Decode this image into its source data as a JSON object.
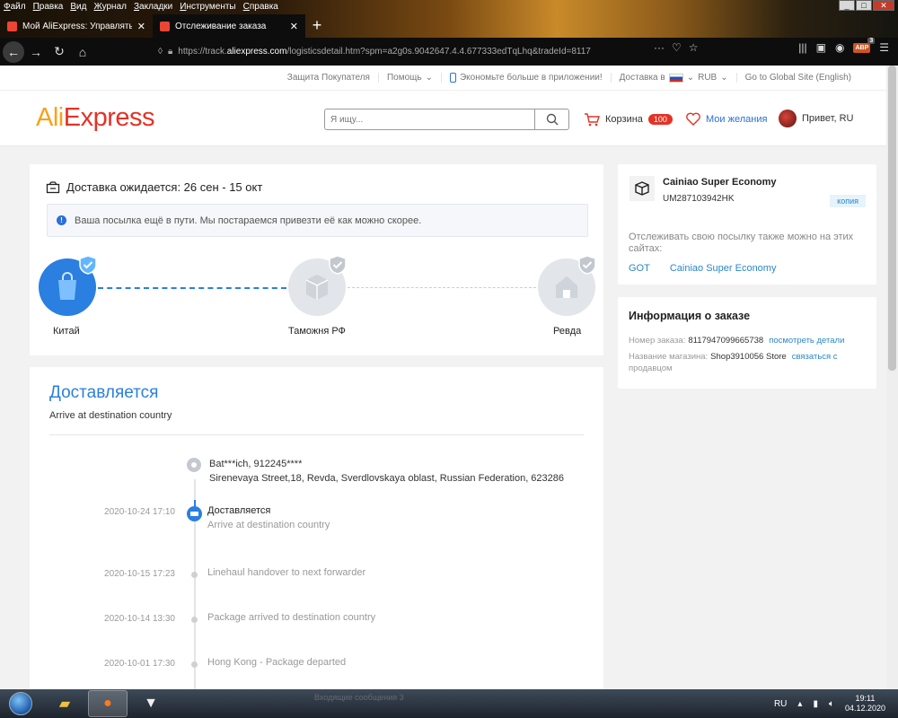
{
  "browser": {
    "menu": [
      "Файл",
      "Правка",
      "Вид",
      "Журнал",
      "Закладки",
      "Инструменты",
      "Справка"
    ],
    "tabs": [
      {
        "title": "Мой AliExpress: Управлять зак",
        "active": false
      },
      {
        "title": "Отслеживание заказа",
        "active": true
      }
    ],
    "url_prefix": "https://track.",
    "url_domain": "aliexpress.com",
    "url_rest": "/logisticsdetail.htm?spm=a2g0s.9042647.4.4.677333edTqLhq&tradeId=8117",
    "abp_label": "ABP",
    "abp_badge": "3"
  },
  "topstrip": {
    "protection": "Защита Покупателя",
    "help": "Помощь",
    "app": "Экономьте больше в приложении!",
    "delivery": "Доставка в",
    "currency": "RUB",
    "global": "Go to Global Site (English)"
  },
  "header": {
    "logo_a": "Ali",
    "logo_b": "Express",
    "search_placeholder": "Я ищу...",
    "cart_label": "Корзина",
    "cart_count": "100",
    "wish_label": "Мои желания",
    "user_label": "Привет, RU"
  },
  "tracking": {
    "eta": "Доставка ожидается: 26 сен - 15 окт",
    "notice": "Ваша посылка ещё в пути. Мы постараемся привезти её как можно скорее.",
    "stages": [
      "Китай",
      "Таможня РФ",
      "Ревда"
    ]
  },
  "status": {
    "title": "Доставляется",
    "subtitle": "Arrive at destination country",
    "addr_name": "Bat***ich,  912245****",
    "addr_line": "Sirenevaya Street,18,  Revda,  Sverdlovskaya oblast,  Russian Federation,  623286",
    "events": [
      {
        "date": "2020-10-24 17:10",
        "title": "Доставляется",
        "desc": "Arrive at destination country"
      },
      {
        "date": "2020-10-15 17:23",
        "title": "Linehaul handover to next forwarder",
        "desc": ""
      },
      {
        "date": "2020-10-14 13:30",
        "title": "Package arrived to destination country",
        "desc": ""
      },
      {
        "date": "2020-10-01 17:30",
        "title": "Hong Kong - Package departed",
        "desc": ""
      }
    ]
  },
  "carrier": {
    "name": "Cainiao Super Economy",
    "number": "UM287103942HK",
    "copy": "копия",
    "also": "Отслеживать свою посылку также можно на этих сайтах:",
    "links": [
      "GOT",
      "Cainiao Super Economy"
    ]
  },
  "order": {
    "title": "Информация о заказе",
    "number_label": "Номер заказа:",
    "number_value": "8117947099665738",
    "details_link": "посмотреть детали",
    "store_label": "Название магазина:",
    "store_value": "Shop3910056 Store",
    "contact_a": "связаться с",
    "contact_b": "продавцом"
  },
  "taskbar": {
    "lang": "RU",
    "time": "19:11",
    "date": "04.12.2020",
    "task_title": "Входящие сообщения 3"
  },
  "colors": {
    "accent": "#2a7fe0",
    "brand_orange": "#f7a21a",
    "brand_red": "#e43225"
  }
}
